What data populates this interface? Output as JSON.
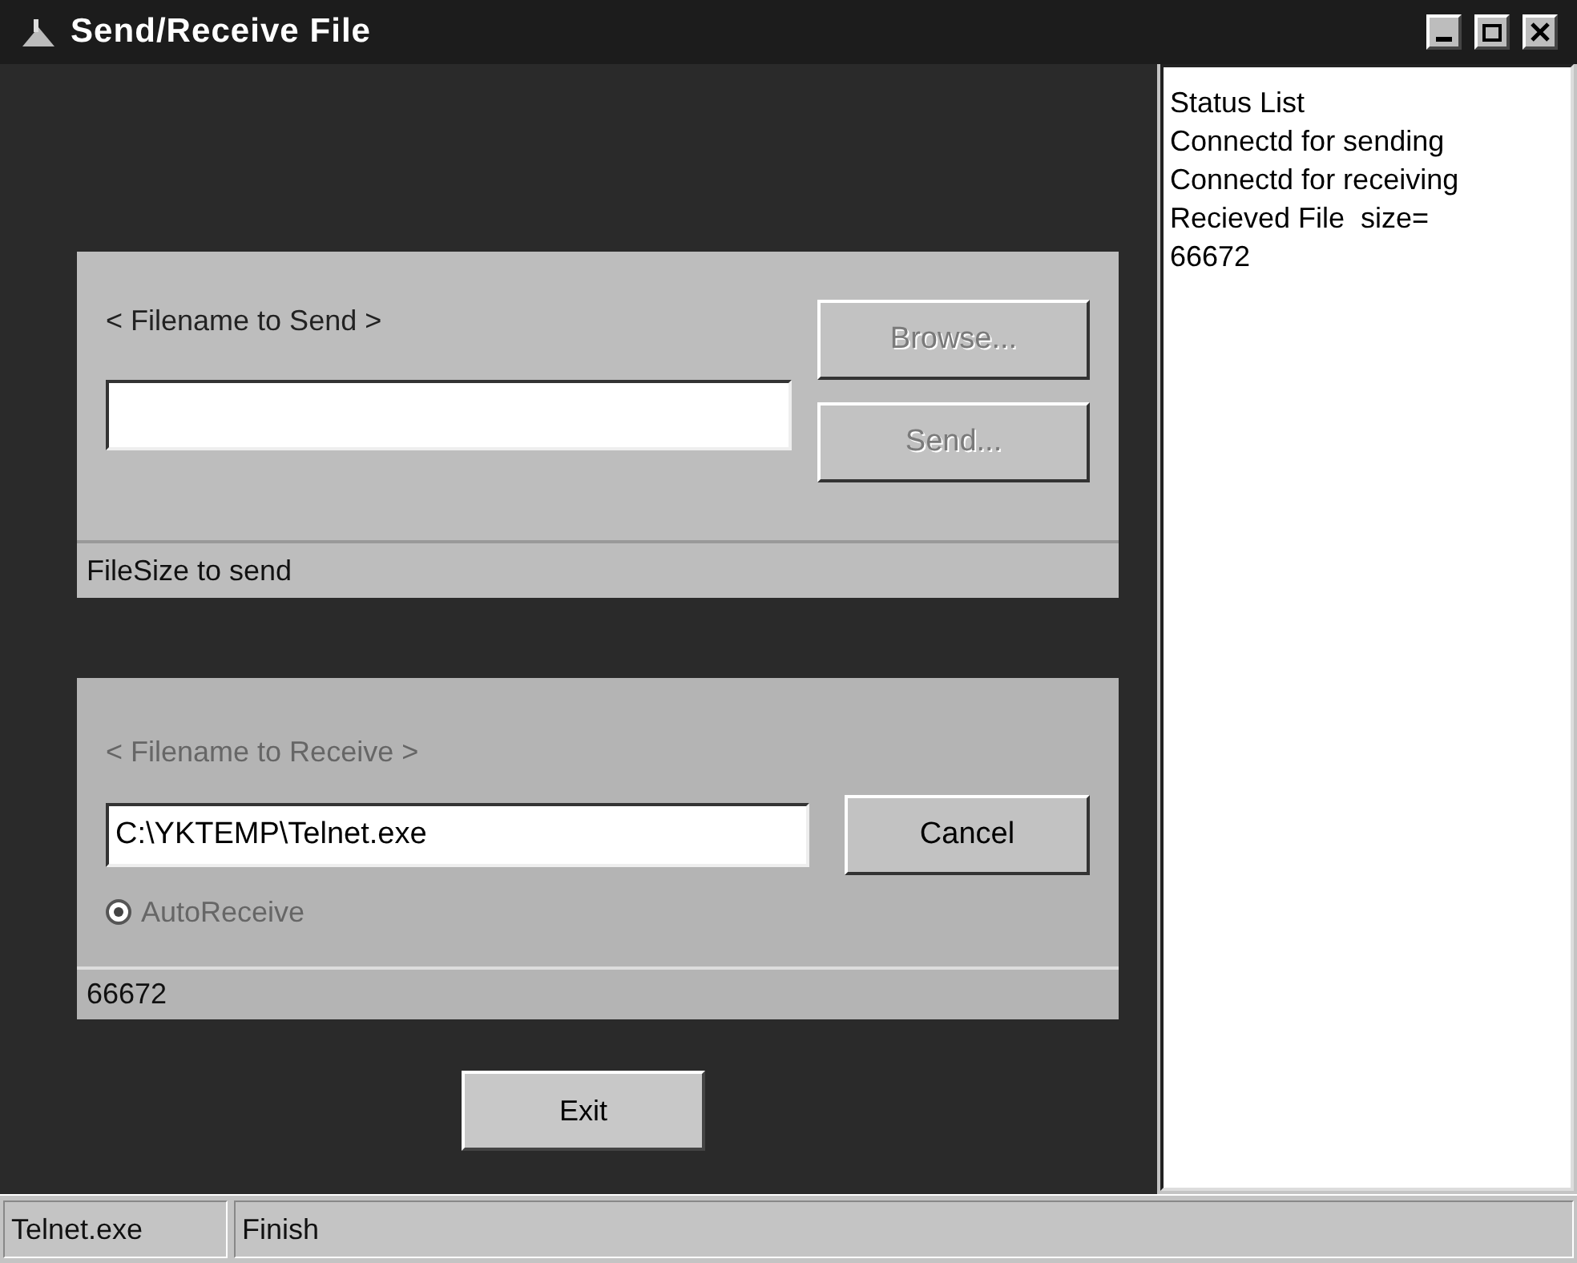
{
  "window": {
    "title": "Send/Receive File"
  },
  "send_panel": {
    "label": "< Filename to Send >",
    "buttons": [
      {
        "label": "Browse...",
        "disabled": true
      },
      {
        "label": "Send...",
        "disabled": true
      }
    ],
    "footer": "FileSize to send"
  },
  "receive_panel": {
    "label": "< Filename to Receive >",
    "label_disabled": true,
    "filename": "C:\\YKTEMP\\Telnet.exe",
    "buttons": [
      {
        "label": "Cancel",
        "disabled": false
      }
    ],
    "auto_receive": {
      "label": "AutoReceive",
      "checked": true,
      "disabled": true
    },
    "footer": "66672"
  },
  "exit_button": {
    "label": "Exit"
  },
  "status_list": [
    "Status List",
    "Connectd for sending",
    "Connectd for receiving",
    "Recieved File  size=",
    "66672"
  ],
  "status_bar": [
    "Telnet.exe",
    "Finish"
  ]
}
